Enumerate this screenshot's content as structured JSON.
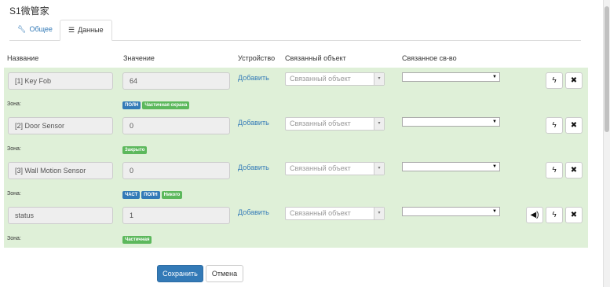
{
  "page_title": "S1微管家",
  "tabs": [
    {
      "label": "Общее",
      "icon": "wrench-icon"
    },
    {
      "label": "Данные",
      "icon": "list-icon"
    }
  ],
  "columns": {
    "name": "Название",
    "value": "Значение",
    "device": "Устройство",
    "linked_object": "Связанный объект",
    "linked_property": "Связанное св-во"
  },
  "rows": [
    {
      "name": "[1] Key Fob",
      "value": "64",
      "add_label": "Добавить",
      "linked_placeholder": "Связанный объект",
      "zone_label": "Зона:",
      "badges": [
        {
          "text": "ПОЛН",
          "color": "#337ab7"
        },
        {
          "text": "Частичная охрана",
          "color": "#5cb85c"
        }
      ]
    },
    {
      "name": "[2] Door Sensor",
      "value": "0",
      "add_label": "Добавить",
      "linked_placeholder": "Связанный объект",
      "zone_label": "Зона:",
      "badges": [
        {
          "text": "Закрыто",
          "color": "#5cb85c"
        }
      ]
    },
    {
      "name": "[3] Wall Motion Sensor",
      "value": "0",
      "add_label": "Добавить",
      "linked_placeholder": "Связанный объект",
      "zone_label": "Зона:",
      "badges": [
        {
          "text": "ЧАСТ",
          "color": "#337ab7"
        },
        {
          "text": "ПОЛН",
          "color": "#337ab7"
        },
        {
          "text": "Никого",
          "color": "#5cb85c"
        }
      ]
    },
    {
      "name": "status",
      "value": "1",
      "add_label": "Добавить",
      "linked_placeholder": "Связанный объект",
      "zone_label": "Зона:",
      "badges": [
        {
          "text": "Частичная",
          "color": "#5cb85c"
        }
      ]
    }
  ],
  "actions": {
    "save": "Сохранить",
    "cancel": "Отмена"
  },
  "colors": {
    "row_background": "#dff0d8",
    "primary": "#337ab7",
    "success": "#5cb85c"
  }
}
